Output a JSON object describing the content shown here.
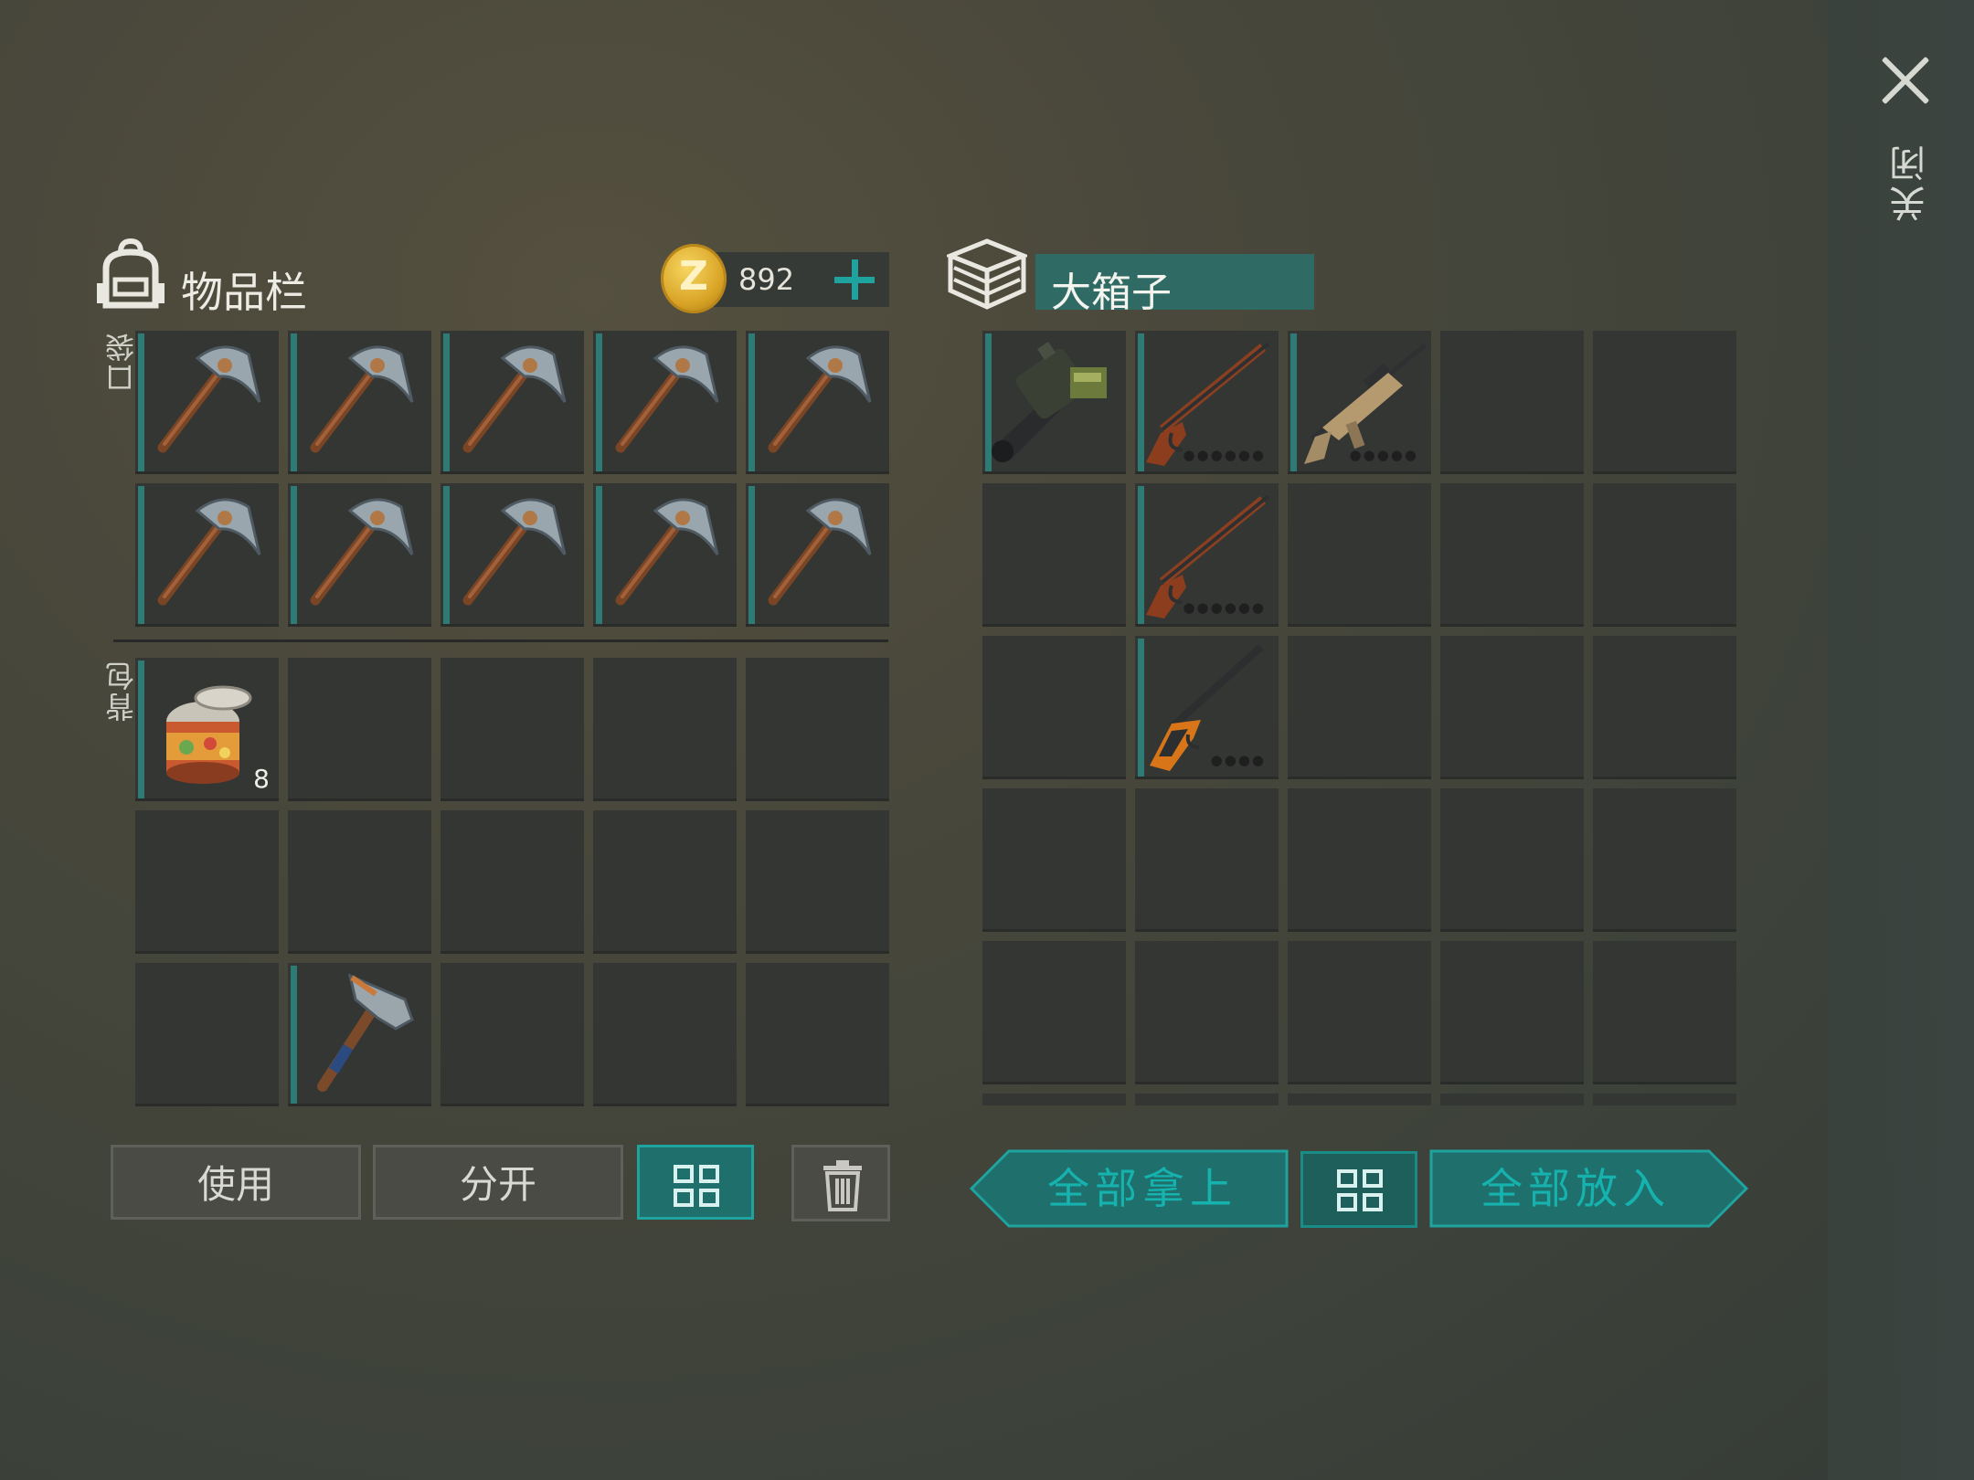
{
  "close": {
    "label": "关闭"
  },
  "inventory": {
    "title": "物品栏",
    "pocket_label": "口袋",
    "backpack_label": "背包",
    "currency": {
      "value": "892",
      "coin_symbol": "Z"
    },
    "pocket_slots": [
      {
        "item": "pickaxe-icon"
      },
      {
        "item": "pickaxe-icon"
      },
      {
        "item": "pickaxe-icon"
      },
      {
        "item": "pickaxe-icon"
      },
      {
        "item": "pickaxe-icon"
      },
      {
        "item": "pickaxe-icon"
      },
      {
        "item": "pickaxe-icon"
      },
      {
        "item": "pickaxe-icon"
      },
      {
        "item": "pickaxe-icon"
      },
      {
        "item": "pickaxe-icon"
      }
    ],
    "backpack_slots": [
      {
        "item": "canned-food-icon",
        "count": "8"
      },
      {},
      {},
      {},
      {},
      {},
      {},
      {},
      {},
      {},
      {},
      {
        "item": "hammer-icon"
      },
      {},
      {},
      {}
    ]
  },
  "storage": {
    "title": "大箱子",
    "slots": [
      {
        "item": "grenade-launcher-icon"
      },
      {
        "item": "lever-rifle-icon",
        "dots": "●●●●●●"
      },
      {
        "item": "assault-rifle-icon",
        "dots": "●●●●●"
      },
      {},
      {},
      {},
      {
        "item": "lever-rifle-icon",
        "dots": "●●●●●●"
      },
      {},
      {},
      {},
      {},
      {
        "item": "hunting-rifle-icon",
        "dots": "●●●●"
      },
      {},
      {},
      {},
      {},
      {},
      {},
      {},
      {},
      {},
      {},
      {},
      {},
      {},
      {},
      {},
      {},
      {},
      {}
    ]
  },
  "buttons": {
    "use": "使用",
    "split": "分开",
    "take_all": "全部拿上",
    "put_all": "全部放入"
  },
  "colors": {
    "accent": "#1ea39f",
    "slot": "#333633",
    "background": "#45463b"
  }
}
